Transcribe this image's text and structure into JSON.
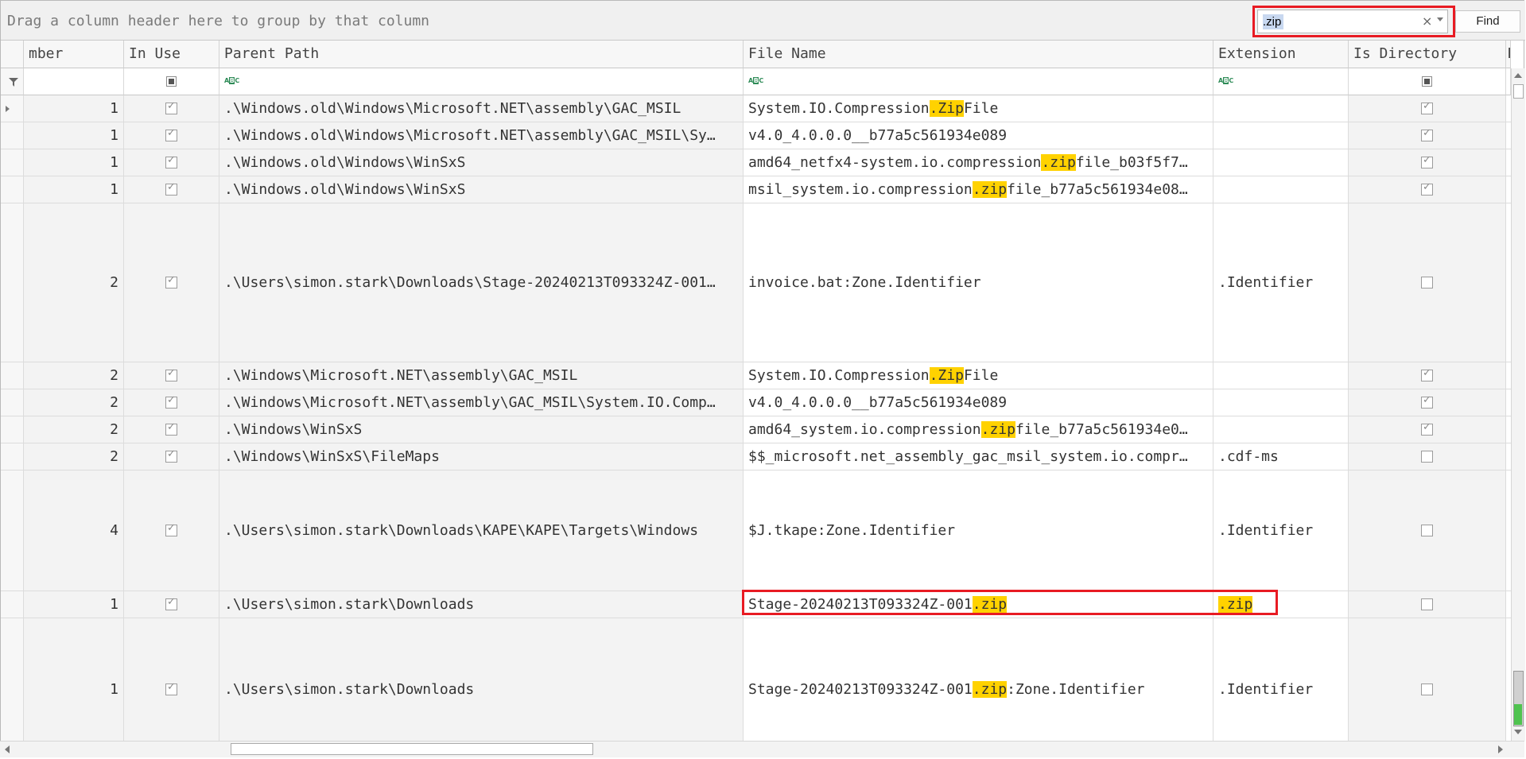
{
  "group_panel": {
    "text": "Drag a column header here to group by that column"
  },
  "find": {
    "value": ".zip",
    "button_label": "Find",
    "clear_glyph": "×"
  },
  "columns": [
    {
      "key": "number",
      "label": "mber"
    },
    {
      "key": "in_use",
      "label": "In Use"
    },
    {
      "key": "parent_path",
      "label": "Parent Path"
    },
    {
      "key": "file_name",
      "label": "File Name"
    },
    {
      "key": "extension",
      "label": "Extension"
    },
    {
      "key": "is_directory",
      "label": "Is Directory"
    },
    {
      "key": "has",
      "label": "Ha"
    }
  ],
  "filter_row": {
    "abc_a": "A",
    "abc_b": "B",
    "abc_c": "C"
  },
  "rows": [
    {
      "number": "1",
      "in_use": true,
      "parent_path": ".\\Windows.old\\Windows\\Microsoft.NET\\assembly\\GAC_MSIL",
      "file_name": [
        {
          "t": "System.IO.Compression"
        },
        {
          "t": ".Zip",
          "hl": true
        },
        {
          "t": "File"
        }
      ],
      "extension": [],
      "is_directory": true
    },
    {
      "number": "1",
      "in_use": true,
      "parent_path": ".\\Windows.old\\Windows\\Microsoft.NET\\assembly\\GAC_MSIL\\Sy…",
      "file_name": [
        {
          "t": "v4.0_4.0.0.0__b77a5c561934e089"
        }
      ],
      "extension": [],
      "is_directory": true
    },
    {
      "number": "1",
      "in_use": true,
      "parent_path": ".\\Windows.old\\Windows\\WinSxS",
      "file_name": [
        {
          "t": "amd64_netfx4-system.io.compression"
        },
        {
          "t": ".zip",
          "hl": true
        },
        {
          "t": "file_b03f5f7…"
        }
      ],
      "extension": [],
      "is_directory": true
    },
    {
      "number": "1",
      "in_use": true,
      "parent_path": ".\\Windows.old\\Windows\\WinSxS",
      "file_name": [
        {
          "t": "msil_system.io.compression"
        },
        {
          "t": ".zip",
          "hl": true
        },
        {
          "t": "file_b77a5c561934e08…"
        }
      ],
      "extension": [],
      "is_directory": true
    },
    {
      "number": "2",
      "in_use": true,
      "parent_path": ".\\Users\\simon.stark\\Downloads\\Stage-20240213T093324Z-001…",
      "file_name": [
        {
          "t": "invoice.bat:Zone.Identifier"
        }
      ],
      "extension": [
        {
          "t": ".Identifier"
        }
      ],
      "is_directory": false
    },
    {
      "number": "2",
      "in_use": true,
      "parent_path": ".\\Windows\\Microsoft.NET\\assembly\\GAC_MSIL",
      "file_name": [
        {
          "t": "System.IO.Compression"
        },
        {
          "t": ".Zip",
          "hl": true
        },
        {
          "t": "File"
        }
      ],
      "extension": [],
      "is_directory": true
    },
    {
      "number": "2",
      "in_use": true,
      "parent_path": ".\\Windows\\Microsoft.NET\\assembly\\GAC_MSIL\\System.IO.Comp…",
      "file_name": [
        {
          "t": "v4.0_4.0.0.0__b77a5c561934e089"
        }
      ],
      "extension": [],
      "is_directory": true
    },
    {
      "number": "2",
      "in_use": true,
      "parent_path": ".\\Windows\\WinSxS",
      "file_name": [
        {
          "t": "amd64_system.io.compression"
        },
        {
          "t": ".zip",
          "hl": true
        },
        {
          "t": "file_b77a5c561934e0…"
        }
      ],
      "extension": [],
      "is_directory": true
    },
    {
      "number": "2",
      "in_use": true,
      "parent_path": ".\\Windows\\WinSxS\\FileMaps",
      "file_name": [
        {
          "t": "$$_microsoft.net_assembly_gac_msil_system.io.compr…"
        }
      ],
      "extension": [
        {
          "t": ".cdf-ms"
        }
      ],
      "is_directory": false
    },
    {
      "number": "4",
      "in_use": true,
      "parent_path": ".\\Users\\simon.stark\\Downloads\\KAPE\\KAPE\\Targets\\Windows",
      "file_name": [
        {
          "t": "$J.tkape:Zone.Identifier"
        }
      ],
      "extension": [
        {
          "t": ".Identifier"
        }
      ],
      "is_directory": false
    },
    {
      "number": "1",
      "in_use": true,
      "parent_path": ".\\Users\\simon.stark\\Downloads",
      "file_name": [
        {
          "t": "Stage-20240213T093324Z-001"
        },
        {
          "t": ".zip",
          "hl": true
        }
      ],
      "extension": [
        {
          "t": ".zip",
          "hl": true
        }
      ],
      "is_directory": false
    },
    {
      "number": "1",
      "in_use": true,
      "parent_path": ".\\Users\\simon.stark\\Downloads",
      "file_name": [
        {
          "t": "Stage-20240213T093324Z-001"
        },
        {
          "t": ".zip",
          "hl": true
        },
        {
          "t": ":Zone.Identifier"
        }
      ],
      "extension": [
        {
          "t": ".Identifier"
        }
      ],
      "is_directory": false
    }
  ],
  "colors": {
    "highlight": "#ffd200",
    "annotation_red": "#e81b23",
    "scroll_green": "#4fc34f"
  }
}
